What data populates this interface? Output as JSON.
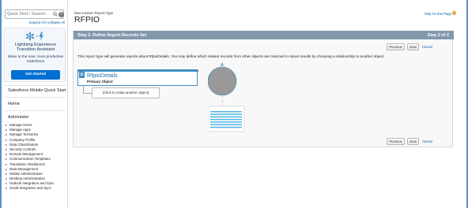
{
  "sidebar": {
    "search_placeholder": "Quick Find / Search...",
    "expand_all": "Expand All",
    "separator": "|",
    "collapse_all": "Collapse All",
    "lex": {
      "title_line1": "Lightning Experience",
      "title_line2": "Transition Assistant",
      "sub_line1": "Move to the new, more productive",
      "sub_line2": "Salesforce",
      "button": "Get Started"
    },
    "quick_start": "Salesforce Mobile Quick Start",
    "home": "Home",
    "administer": "Administer",
    "admin_items": [
      "Manage Users",
      "Manage Apps",
      "Manage Territories",
      "Company Profile",
      "Data Classification",
      "Security Controls",
      "Domain Management",
      "Communication Templates",
      "Translation Workbench",
      "Data Management",
      "Mobile Administration",
      "Desktop Administration",
      "Outlook Integration and Sync",
      "Gmail Integration and Sync"
    ]
  },
  "main": {
    "breadcrumb": "New Custom Report Type",
    "title": "RFPIO",
    "help_link": "Help for this Page",
    "step_title": "Step 2. Define Report Records Set",
    "step_count": "Step 2 of 2",
    "buttons": {
      "previous": "Previous",
      "save": "Save",
      "cancel": "Cancel"
    },
    "description": "This report type will generate reports about RfpioDetails. You may define which related records from other objects are returned in report results by choosing a relationship to another object.",
    "primary_object": {
      "letter": "A",
      "name": "RfpioDetails",
      "label": "Primary Object"
    },
    "relate_label": "(Click to relate another object)",
    "diagram": {
      "letter": "A",
      "plus": "+"
    }
  },
  "colors": {
    "panel_header": "#8298ac",
    "primary_blue": "#3e8fc2",
    "link_blue": "#015ba7",
    "get_started_blue": "#0070d2",
    "diagram_circle": "#999999",
    "diagram_lines": "#4fb3e8"
  },
  "icons": [
    "search-icon",
    "clear-icon",
    "lightning-transition-icon",
    "help-icon"
  ]
}
